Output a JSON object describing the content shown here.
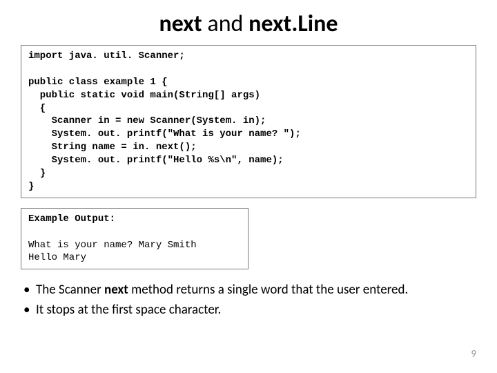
{
  "title": {
    "t1": "next",
    "t2": " and ",
    "t3": "next.Line"
  },
  "code": "import java. util. Scanner;\n\npublic class example 1 {\n  public static void main(String[] args)\n  {\n    Scanner in = new Scanner(System. in);\n    System. out. printf(\"What is your name? \");\n    String name = in. next();\n    System. out. printf(\"Hello %s\\n\", name);\n  }\n}",
  "output": {
    "heading": "Example Output:",
    "body": "What is your name? Mary Smith\nHello Mary"
  },
  "bullets": {
    "b1a": "The Scanner ",
    "b1b": "next",
    "b1c": " method returns a single word that the user entered.",
    "b2": "It stops at the first space character."
  },
  "page": "9"
}
